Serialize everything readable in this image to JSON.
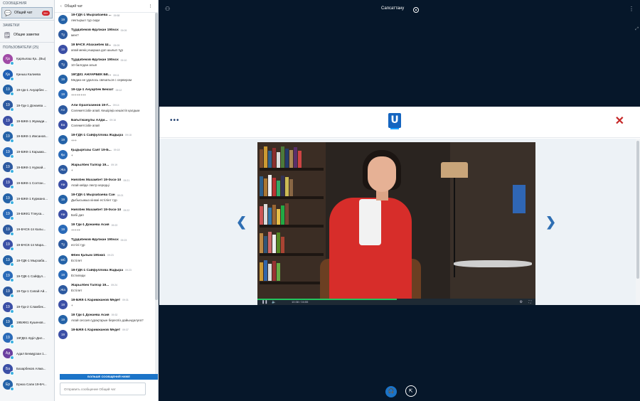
{
  "sidebar": {
    "messages_header": "СООБЩЕНИЯ",
    "public_chat": {
      "label": "Общий чат",
      "badge": "99+"
    },
    "notes_header": "ЗАМЕТКИ",
    "shared_notes": {
      "label": "Общие заметки"
    },
    "users_header": "ПОЛЬЗОВАТЕЛИ (25)",
    "users": [
      {
        "initials": "Қа",
        "name": "Қарлығаш Қа...(Вы)",
        "color": "#a04aa6"
      },
      {
        "initials": "Қа",
        "name": "Қаныш Калиева",
        "color": "#1f5fb4"
      },
      {
        "initials": "19",
        "name": "19-ғдк-1 Ануарбек ...",
        "color": "#2563a8"
      },
      {
        "initials": "19",
        "name": "19-Гдк-1 Донаева ...",
        "color": "#2d5aa0"
      },
      {
        "initials": "19",
        "name": "19-БЖК-1 Жумади...",
        "color": "#3b4fa6"
      },
      {
        "initials": "19",
        "name": "19-БЖК-1 Имсанов...",
        "color": "#2563a8"
      },
      {
        "initials": "19",
        "name": "19-БЖК-1 Карыма...",
        "color": "#2a6ab8"
      },
      {
        "initials": "19",
        "name": "19-БЖК-1 Нуркай...",
        "color": "#2d5aa0"
      },
      {
        "initials": "19",
        "name": "19-БЖК-1 Солтан...",
        "color": "#3b4fa6"
      },
      {
        "initials": "19",
        "name": "19-БЖК-1 Курмано...",
        "color": "#2563a8"
      },
      {
        "initials": "19",
        "name": "19-БЖК1 Тлеуха...",
        "color": "#2a6ab8"
      },
      {
        "initials": "19",
        "name": "19-БЧСК-1п Калы...",
        "color": "#2d5aa0"
      },
      {
        "initials": "19",
        "name": "19-БЧСК-1п Мара...",
        "color": "#3b4fa6"
      },
      {
        "initials": "19",
        "name": "19-ГДК-1 Мырзаба...",
        "color": "#2563a8"
      },
      {
        "initials": "19",
        "name": "19-ГДК-1 Сайфул...",
        "color": "#2a6ab8"
      },
      {
        "initials": "19",
        "name": "19-Гдк-1 Сапай Ай...",
        "color": "#2d5aa0"
      },
      {
        "initials": "19",
        "name": "19-Гдк-2 Сламбек...",
        "color": "#3b4fa6"
      },
      {
        "initials": "19",
        "name": "19БЖК1 Кушенов...",
        "color": "#2563a8"
      },
      {
        "initials": "19",
        "name": "19ГДК1 Әділ Дил...",
        "color": "#2a6ab8"
      },
      {
        "initials": "Ад",
        "name": "Адал Бекмұрзан 1...",
        "color": "#6a3fa0"
      },
      {
        "initials": "Ба",
        "name": "Базарбеков Алма...",
        "color": "#3b4fa6"
      },
      {
        "initials": "Ер",
        "name": "Ерназ Сапи 19-БЧ...",
        "color": "#2563a8"
      }
    ]
  },
  "chat": {
    "back_label": "Общий чат",
    "new_messages_label": "БОЛЬШЕ СООБЩЕНИЙ НИЖЕ",
    "input_placeholder": "Отправить сообщение Общий чат",
    "messages": [
      {
        "initials": "19",
        "color": "#2563a8",
        "name": "19-ГДК-1 Мырзабаева ...",
        "time": "09:58",
        "text": "лектырыл тур сиди",
        "offline": true
      },
      {
        "initials": "Тұ",
        "color": "#2d5aa0",
        "name": "Тұрдабеков Әділжан 19бчск",
        "time": "09:09",
        "text": "мен?",
        "offline": false
      },
      {
        "initials": "19",
        "color": "#3b4fa6",
        "name": "19 БЧСК Абаханбек Ш...",
        "time": "09:09",
        "text": "апай менің ешқаша доп шығып тұр",
        "offline": true
      },
      {
        "initials": "Тұ",
        "color": "#2d5aa0",
        "name": "Тұрдабеков Әділжан 19бчск",
        "time": "09:10",
        "text": "10 баллдан алып",
        "offline": false
      },
      {
        "initials": "19",
        "color": "#2563a8",
        "name": "19ГДК1 АНУАРБЕК БЕ...",
        "time": "09:11",
        "text": "Медиа не удалось связаться с сервером",
        "offline": true
      },
      {
        "initials": "19",
        "color": "#2a6ab8",
        "name": "19-гдк-1 Ануарбек Бекзат",
        "time": "09:12",
        "text": "++++++++",
        "offline": false
      },
      {
        "initials": "Ал",
        "color": "#2d5aa0",
        "name": "Али Оразғазинов 19-Г...",
        "time": "09:14",
        "text": "Сәлеметсізбе апай. Кешіріңіз кешіктіп қалдым",
        "offline": true
      },
      {
        "initials": "Ба",
        "color": "#3b4fa6",
        "name": "Бағытжанұлы Алди...",
        "time": "09:16",
        "text": "Сәлеметсізбе апай",
        "offline": true
      },
      {
        "initials": "19",
        "color": "#2563a8",
        "name": "19-ГДК-1 Сайфуллова Жадыра",
        "time": "09:18",
        "text": "+++",
        "offline": false
      },
      {
        "initials": "Қы",
        "color": "#2a6ab8",
        "name": "Қыдырғазы Саят 19-Б...",
        "time": "09:18",
        "text": "+",
        "offline": true
      },
      {
        "initials": "Жа",
        "color": "#2d5aa0",
        "name": "Жарылбек Талғар 19...",
        "time": "09:19",
        "text": "+",
        "offline": true
      },
      {
        "initials": "Ни",
        "color": "#3b4fa6",
        "name": "Ниязбек Махамбет 19-бчск-1п",
        "time": "09:21",
        "text": "Апай кейде лектр кередці",
        "offline": false
      },
      {
        "initials": "19",
        "color": "#2563a8",
        "name": "19-ГДК-1 Мырзабаева Сан",
        "time": "09:21",
        "text": "Дыбысымыз кінәмі естілінт тур",
        "offline": false
      },
      {
        "initials": "Ни",
        "color": "#3b4fa6",
        "name": "Ниязбек Махамбет 19-бчск-1п",
        "time": "09:22",
        "text": "Бәбі дап",
        "offline": false
      },
      {
        "initials": "19",
        "color": "#2a6ab8",
        "name": "19 Гдк-1 Донаева Асия",
        "time": "09:22",
        "text": "+++++",
        "offline": true
      },
      {
        "initials": "Тұ",
        "color": "#2d5aa0",
        "name": "Тұрдабеков Әділжан 19бчск",
        "time": "09:23",
        "text": "естілі тұр",
        "offline": false
      },
      {
        "initials": "Өб",
        "color": "#2563a8",
        "name": "Өбен Қалым 19бжк1",
        "time": "09:23",
        "text": "Естілет",
        "offline": false
      },
      {
        "initials": "19",
        "color": "#2a6ab8",
        "name": "19-ГДК-1 Сайфуллова Жадыра",
        "time": "09:23",
        "text": "Естиледи",
        "offline": false
      },
      {
        "initials": "Жа",
        "color": "#2d5aa0",
        "name": "Жарылбек Талғар 19...",
        "time": "09:24",
        "text": "Естілет",
        "offline": true
      },
      {
        "initials": "19",
        "color": "#3b4fa6",
        "name": "19-БЖК-1 Каримжанов Медет",
        "time": "09:31",
        "text": "+",
        "offline": false
      },
      {
        "initials": "19",
        "color": "#2563a8",
        "name": "19 Гдк-1 Донаева Асия",
        "time": "09:32",
        "text": "Апай сессия сұрақтарын береспіз дайындалуға?",
        "offline": true
      },
      {
        "initials": "19",
        "color": "#3b4fa6",
        "name": "19-БЖК-1 Каримжанов Медет",
        "time": "09:37",
        "text": "",
        "offline": false
      }
    ]
  },
  "main": {
    "title": "Сапсаттану",
    "modal": {
      "logo": "U"
    },
    "video": {
      "current_time": "10:38 / 04:55"
    },
    "progress": 0.5
  },
  "colors": {
    "accent": "#1b74c8",
    "close": "#c62828",
    "background": "#06172a"
  }
}
